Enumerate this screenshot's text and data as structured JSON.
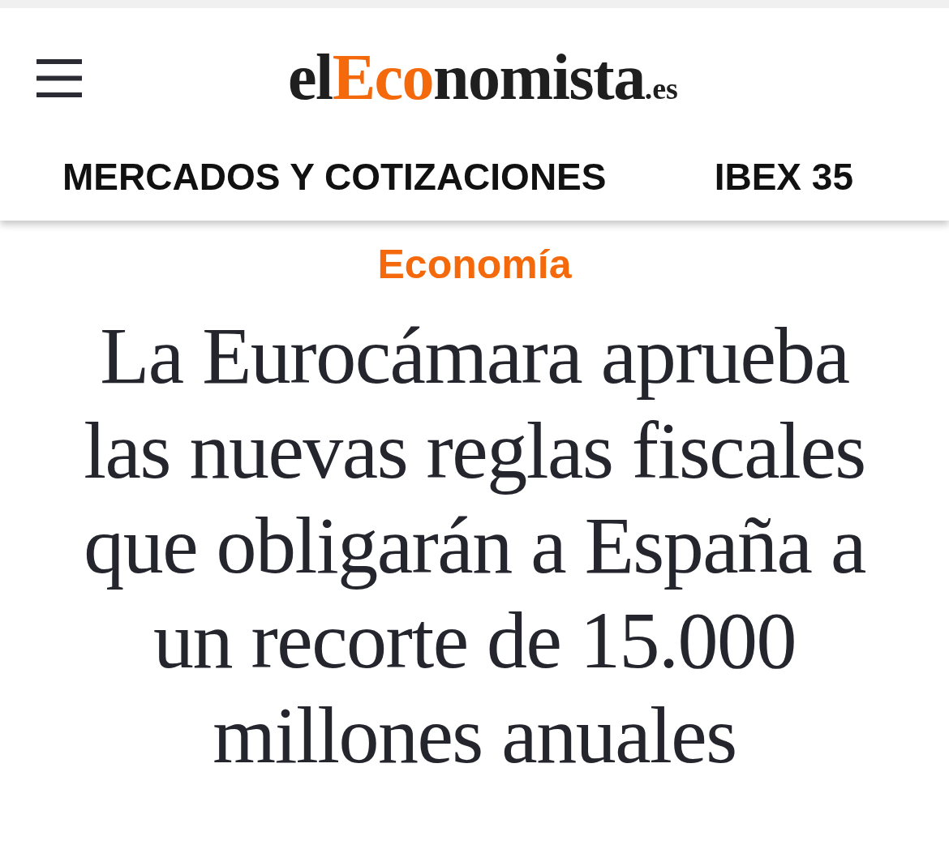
{
  "header": {
    "logo": {
      "parts": [
        {
          "text": "el",
          "kind": "plain"
        },
        {
          "text": "Eco",
          "kind": "accent"
        },
        {
          "text": "nomista",
          "kind": "plain"
        },
        {
          "text": ".es",
          "kind": "domain"
        }
      ]
    },
    "nav": [
      "MERCADOS Y COTIZACIONES",
      "IBEX 35"
    ]
  },
  "article": {
    "section": "Economía",
    "headline": "La Eurocámara aprueba las nuevas reglas fiscales que obligarán a España a un recorte de 15.000 millones anuales"
  }
}
